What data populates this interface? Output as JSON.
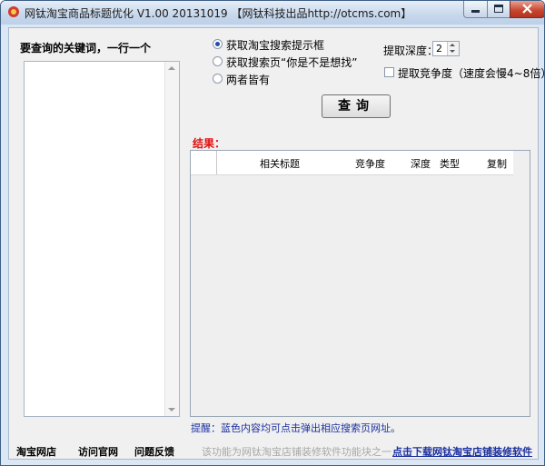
{
  "window": {
    "title": "网钛淘宝商品标题优化 V1.00 20131019 【网钛科技出品http://otcms.com】"
  },
  "left_panel": {
    "label": "要查询的关键词，一行一个",
    "keywords_value": ""
  },
  "mode": {
    "options": [
      {
        "label": "获取淘宝搜索提示框",
        "selected": true
      },
      {
        "label": "获取搜索页“你是不是想找”",
        "selected": false
      },
      {
        "label": "两者皆有",
        "selected": false
      }
    ]
  },
  "depth": {
    "label": "提取深度：",
    "value": "2"
  },
  "competition": {
    "label": "提取竞争度（速度会慢4~8倍）",
    "checked": false
  },
  "query_button": {
    "label": "查询"
  },
  "results": {
    "label": "结果：",
    "columns": [
      "相关标题",
      "竞争度",
      "深度",
      "类型",
      "复制"
    ]
  },
  "tip": {
    "text": "提醒：蓝色内容均可点击弹出相应搜索页网址。"
  },
  "footer": {
    "links": [
      "淘宝网店",
      "访问官网",
      "问题反馈"
    ],
    "note": "该功能为网钛淘宝店铺装修软件功能块之一",
    "download_link": "点击下载网钛淘宝店铺装修软件"
  },
  "colors": {
    "accent_red": "#e01010",
    "link_blue": "#1a2fa0",
    "title_bar": "#c9d9ec"
  }
}
